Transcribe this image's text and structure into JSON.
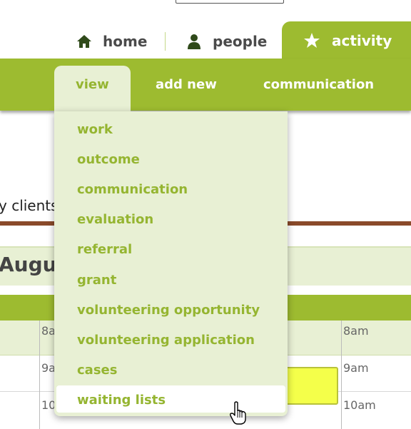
{
  "tabs": {
    "home": {
      "label": "home",
      "icon": "home-icon"
    },
    "people": {
      "label": "people",
      "icon": "person-icon"
    },
    "activity": {
      "label": "activity",
      "icon": "star-icon",
      "active": true
    }
  },
  "submenu": {
    "view": "view",
    "add_new": "add new",
    "communication": "communication"
  },
  "dropdown": {
    "items": [
      "work",
      "outcome",
      "communication",
      "evaluation",
      "referral",
      "grant",
      "volunteering opportunity",
      "volunteering application",
      "cases",
      "waiting lists"
    ],
    "hovered": "waiting lists"
  },
  "background": {
    "clients_text": "y clients",
    "month": "Augu",
    "times_left": [
      "8a",
      "9a",
      "10"
    ],
    "times_right": [
      "8am",
      "9am",
      "10am"
    ]
  },
  "colors": {
    "green": "#9dbb30",
    "pale_green": "#e8f0d4",
    "link_green": "#95b531",
    "event_yellow": "#f4ff4a"
  }
}
